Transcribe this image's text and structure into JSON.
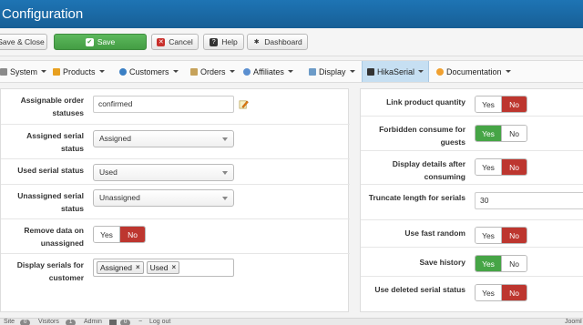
{
  "header": {
    "title": "Configuration"
  },
  "toolbar": {
    "save_close_label": "Save & Close",
    "save_label": "Save",
    "cancel_label": "Cancel",
    "help_label": "Help",
    "dashboard_label": "Dashboard"
  },
  "nav": {
    "items": [
      {
        "label": "System"
      },
      {
        "label": "Products"
      },
      {
        "label": "Customers"
      },
      {
        "label": "Orders"
      },
      {
        "label": "Affiliates"
      },
      {
        "label": "Display"
      },
      {
        "label": "HikaSerial"
      },
      {
        "label": "Documentation"
      }
    ]
  },
  "left_panel": {
    "assignable_order_statuses": {
      "label": "Assignable order statuses",
      "value": "confirmed"
    },
    "assigned_serial_status": {
      "label": "Assigned serial status",
      "value": "Assigned"
    },
    "used_serial_status": {
      "label": "Used serial status",
      "value": "Used"
    },
    "unassigned_serial_status": {
      "label": "Unassigned serial status",
      "value": "Unassigned"
    },
    "remove_data_on_unassigned": {
      "label": "Remove data on unassigned",
      "yes": "Yes",
      "no": "No",
      "selected": "No"
    },
    "display_serials_for_customer": {
      "label": "Display serials for customer",
      "tags": [
        "Assigned",
        "Used"
      ],
      "remove_glyph": "×"
    }
  },
  "right_panel": {
    "link_product_quantity": {
      "label": "Link product quantity",
      "yes": "Yes",
      "no": "No",
      "selected": "No"
    },
    "forbidden_consume_for_guests": {
      "label": "Forbidden consume for guests",
      "yes": "Yes",
      "no": "No",
      "selected": "Yes"
    },
    "display_details_after_consuming": {
      "label": "Display details after consuming",
      "yes": "Yes",
      "no": "No",
      "selected": "No"
    },
    "truncate_length_for_serials": {
      "label": "Truncate length for serials",
      "value": "30"
    },
    "use_fast_random": {
      "label": "Use fast random",
      "yes": "Yes",
      "no": "No",
      "selected": "No"
    },
    "save_history": {
      "label": "Save history",
      "yes": "Yes",
      "no": "No",
      "selected": "Yes"
    },
    "use_deleted_serial_status": {
      "label": "Use deleted serial status",
      "yes": "Yes",
      "no": "No",
      "selected": "No"
    }
  },
  "footer": {
    "view_site": "Site",
    "visitors_count": "0",
    "visitors_label": "Visitors",
    "admin_count": "1",
    "admin_label": "Admin",
    "messages_count": "0",
    "logout_label": "Log out",
    "right_text": "Jooml"
  },
  "colors": {
    "header_blue": "#1e74b4",
    "save_green": "#5cb85c",
    "toggle_red": "#bd362f",
    "toggle_green": "#46a546",
    "nav_active": "#c6dff2"
  },
  "icons": {
    "save": "check-icon",
    "cancel": "cancel-circle-icon",
    "help": "help-circle-icon",
    "dashboard": "dashboard-icon",
    "edit": "pencil-edit-icon"
  }
}
